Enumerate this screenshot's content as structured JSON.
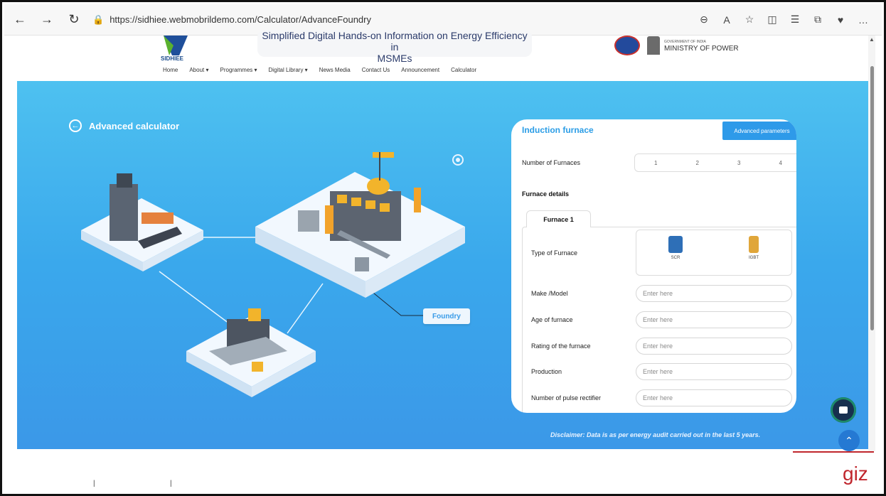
{
  "browser": {
    "url": "https://sidhiee.webmobrildemo.com/Calculator/AdvanceFoundry"
  },
  "site": {
    "logo_text": "SIDHIEE",
    "tagline_line1": "Simplified Digital Hands-on Information on Energy Efficiency in",
    "tagline_line2": "MSMEs",
    "ministry_small": "GOVERNMENT OF INDIA",
    "ministry_big": "MINISTRY OF POWER",
    "nav": [
      "Home",
      "About ▾",
      "Programmes ▾",
      "Digital Library ▾",
      "News Media",
      "Contact Us",
      "Announcement",
      "Calculator"
    ]
  },
  "hero": {
    "back_label": "Advanced calculator",
    "foundry_tag": "Foundry",
    "disclaimer": "Disclaimer: Data is as per energy audit carried out in the last 5 years."
  },
  "panel": {
    "title": "Induction furnace",
    "advanced_button": "Advanced parameters",
    "num_furnaces_label": "Number of Furnaces",
    "num_furnaces_options": [
      "1",
      "2",
      "3",
      "4"
    ],
    "details_title": "Furnace details",
    "tab_label": "Furnace 1",
    "type_label": "Type of Furnace",
    "type_options": [
      "SCR",
      "IGBT"
    ],
    "fields": [
      {
        "label": "Make /Model",
        "placeholder": "Enter here"
      },
      {
        "label": "Age of furnace",
        "placeholder": "Enter here"
      },
      {
        "label": "Rating of the furnace",
        "placeholder": "Enter here"
      },
      {
        "label": "Production",
        "placeholder": "Enter here"
      },
      {
        "label": "Number of pulse rectifier",
        "placeholder": "Enter here"
      }
    ]
  },
  "footer": {
    "giz": "giz"
  },
  "colors": {
    "accent": "#2e9ae9",
    "hero_top": "#4ec1f0",
    "hero_bottom": "#3b98e8",
    "giz_red": "#c0262d"
  }
}
